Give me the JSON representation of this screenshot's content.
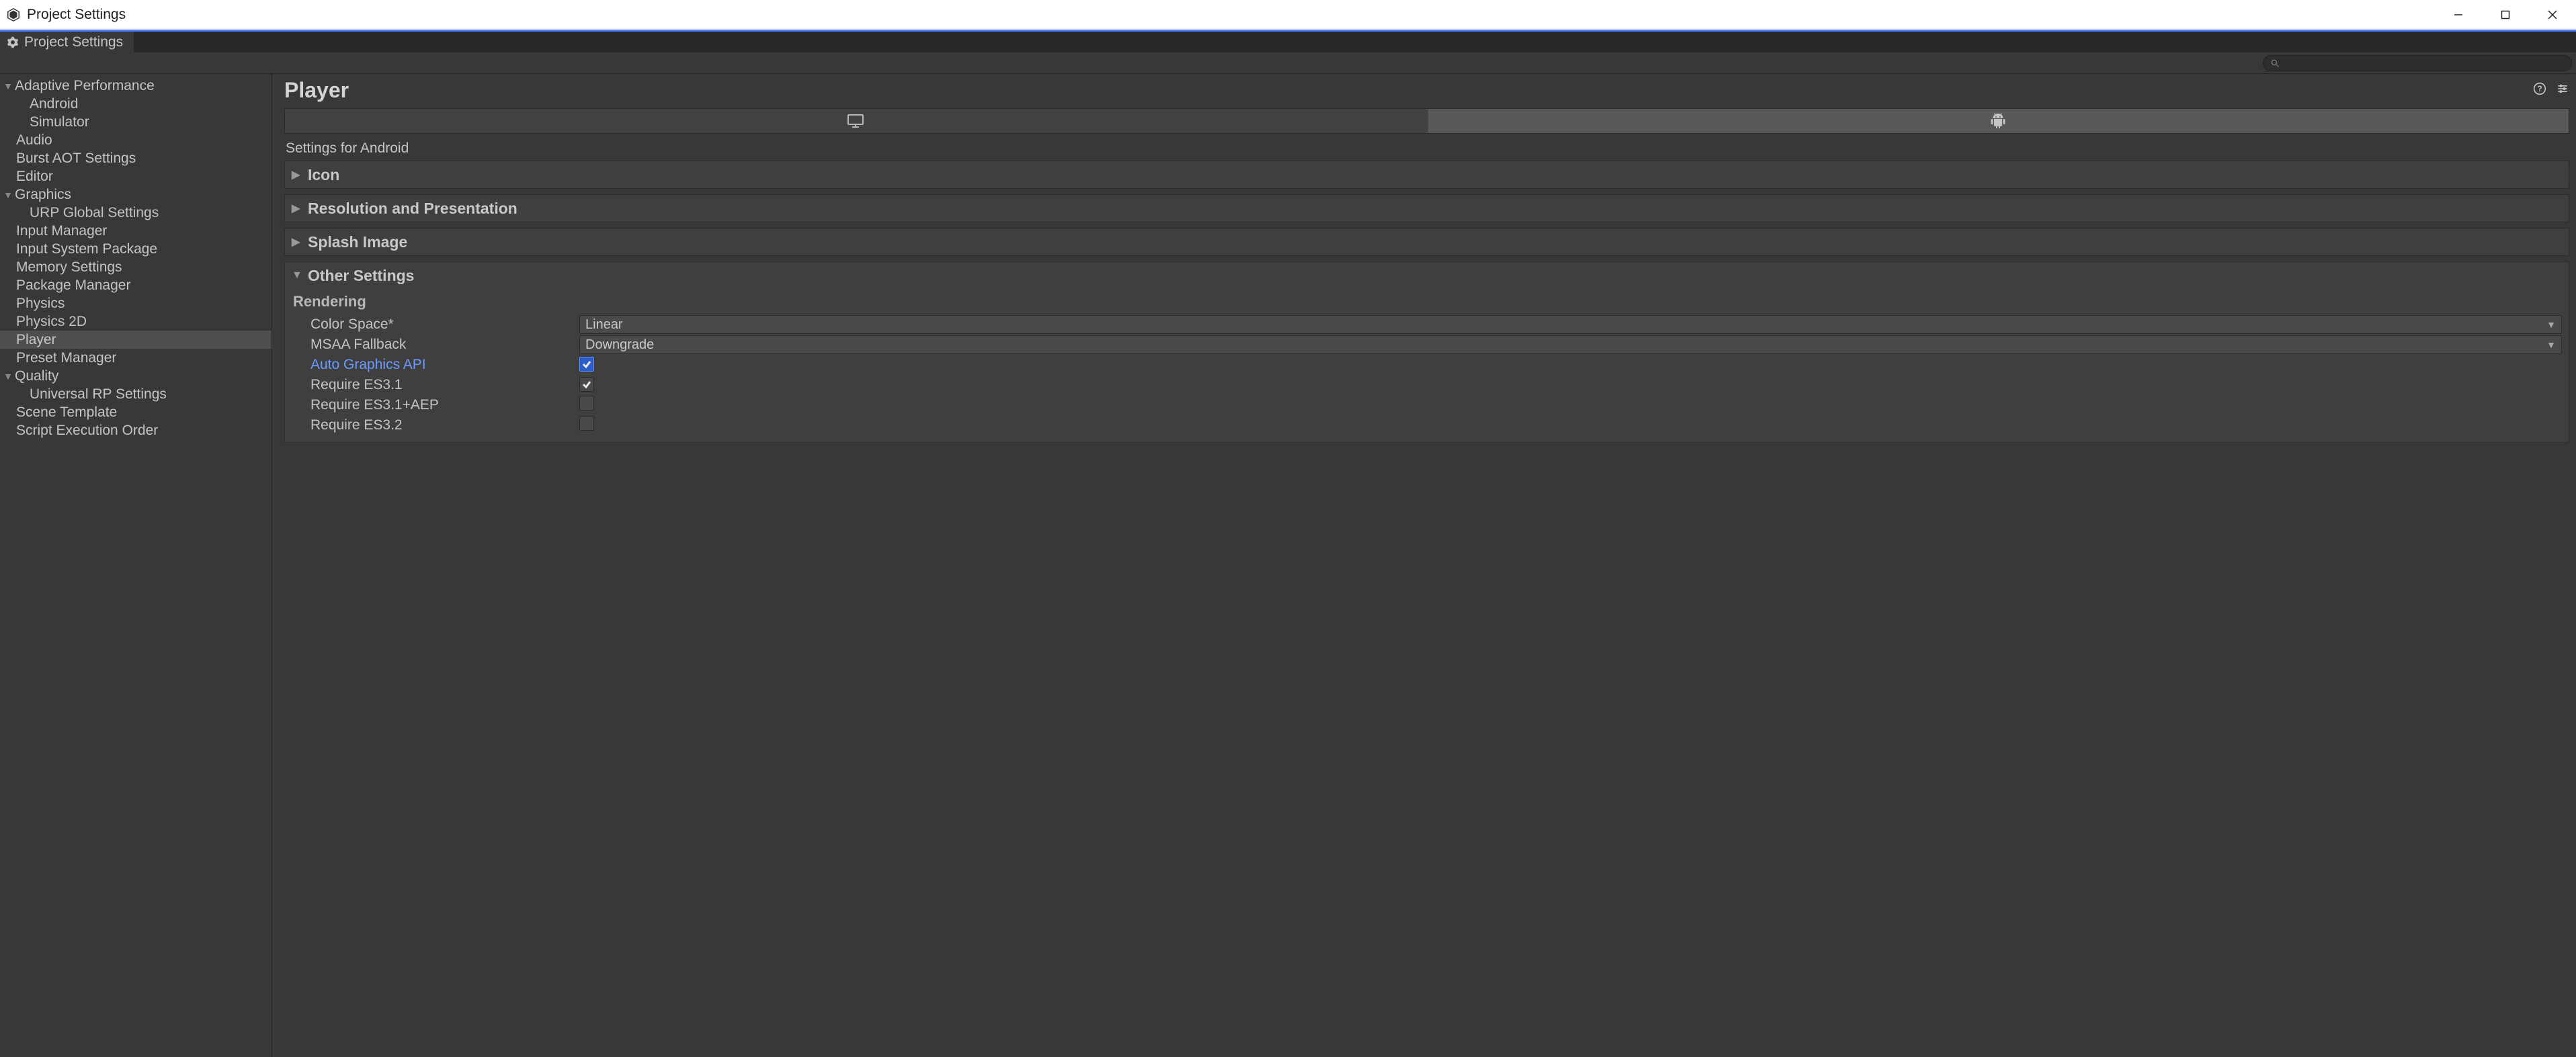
{
  "window": {
    "title": "Project Settings"
  },
  "tab": {
    "label": "Project Settings"
  },
  "search": {
    "value": ""
  },
  "sidebar": {
    "items": [
      {
        "label": "Adaptive Performance",
        "depth": 0,
        "expandable": true,
        "expanded": true,
        "selected": false
      },
      {
        "label": "Android",
        "depth": 1,
        "expandable": false,
        "selected": false
      },
      {
        "label": "Simulator",
        "depth": 1,
        "expandable": false,
        "selected": false
      },
      {
        "label": "Audio",
        "depth": 0,
        "expandable": false,
        "selected": false
      },
      {
        "label": "Burst AOT Settings",
        "depth": 0,
        "expandable": false,
        "selected": false
      },
      {
        "label": "Editor",
        "depth": 0,
        "expandable": false,
        "selected": false
      },
      {
        "label": "Graphics",
        "depth": 0,
        "expandable": true,
        "expanded": true,
        "selected": false
      },
      {
        "label": "URP Global Settings",
        "depth": 1,
        "expandable": false,
        "selected": false
      },
      {
        "label": "Input Manager",
        "depth": 0,
        "expandable": false,
        "selected": false
      },
      {
        "label": "Input System Package",
        "depth": 0,
        "expandable": false,
        "selected": false
      },
      {
        "label": "Memory Settings",
        "depth": 0,
        "expandable": false,
        "selected": false
      },
      {
        "label": "Package Manager",
        "depth": 0,
        "expandable": false,
        "selected": false
      },
      {
        "label": "Physics",
        "depth": 0,
        "expandable": false,
        "selected": false
      },
      {
        "label": "Physics 2D",
        "depth": 0,
        "expandable": false,
        "selected": false
      },
      {
        "label": "Player",
        "depth": 0,
        "expandable": false,
        "selected": true
      },
      {
        "label": "Preset Manager",
        "depth": 0,
        "expandable": false,
        "selected": false
      },
      {
        "label": "Quality",
        "depth": 0,
        "expandable": true,
        "expanded": true,
        "selected": false
      },
      {
        "label": "Universal RP Settings",
        "depth": 1,
        "expandable": false,
        "selected": false
      },
      {
        "label": "Scene Template",
        "depth": 0,
        "expandable": false,
        "selected": false
      },
      {
        "label": "Script Execution Order",
        "depth": 0,
        "expandable": false,
        "selected": false
      }
    ]
  },
  "content": {
    "title": "Player",
    "platform_caption": "Settings for Android",
    "platforms": [
      {
        "name": "desktop",
        "active": false
      },
      {
        "name": "android",
        "active": true
      }
    ],
    "foldouts": {
      "icon": {
        "label": "Icon",
        "expanded": false
      },
      "resolution": {
        "label": "Resolution and Presentation",
        "expanded": false
      },
      "splash": {
        "label": "Splash Image",
        "expanded": false
      },
      "other": {
        "label": "Other Settings",
        "expanded": true
      }
    },
    "rendering": {
      "group_label": "Rendering",
      "color_space": {
        "label": "Color Space*",
        "value": "Linear"
      },
      "msaa_fallback": {
        "label": "MSAA Fallback",
        "value": "Downgrade"
      },
      "auto_graphics_api": {
        "label": "Auto Graphics API",
        "checked": true,
        "override": true
      },
      "require_es31": {
        "label": "Require ES3.1",
        "checked": true
      },
      "require_es31aep": {
        "label": "Require ES3.1+AEP",
        "checked": false
      },
      "require_es32": {
        "label": "Require ES3.2",
        "checked": false
      }
    }
  }
}
